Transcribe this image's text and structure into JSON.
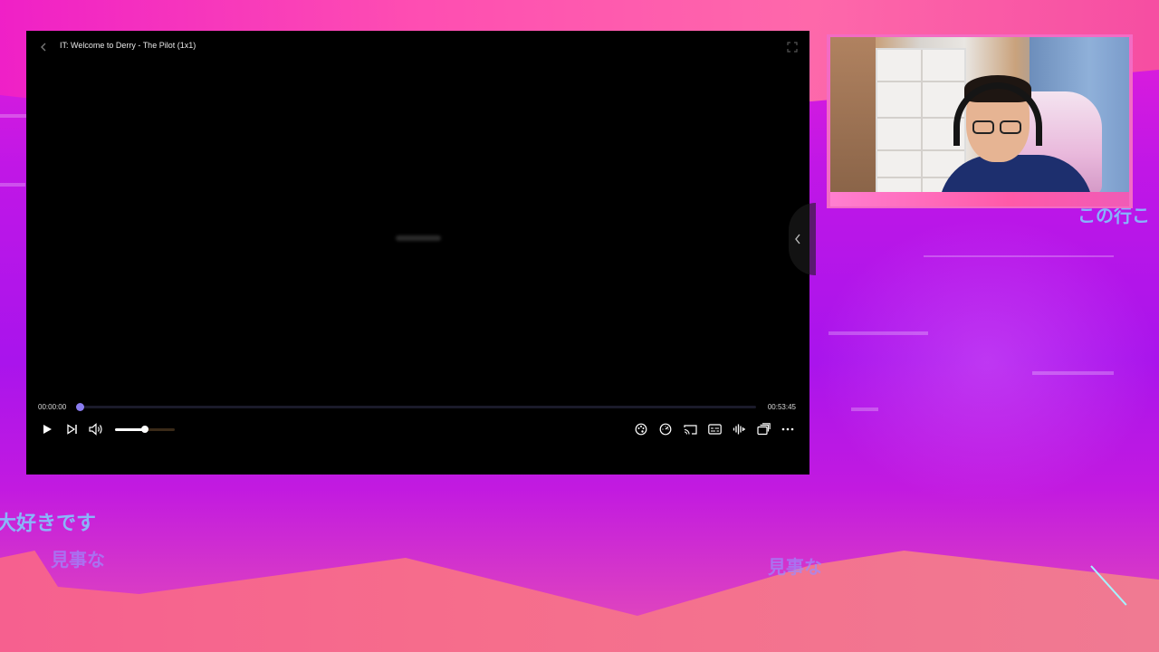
{
  "player": {
    "title": "IT: Welcome to Derry - The Pilot (1x1)",
    "time_current": "00:00:00",
    "time_total": "00:53:45",
    "progress_fraction": 0.0,
    "volume_fraction": 0.5,
    "accent_color": "#8a7cf0"
  },
  "overlay_text": {
    "jp_1": "大好きです",
    "jp_2": "見事な",
    "jp_3": "見事な",
    "jp_4": "この行こ"
  },
  "icons": {
    "back": "chevron-left-icon",
    "fullscreen": "fullscreen-icon",
    "side_panel": "chevron-left-icon",
    "play": "play-icon",
    "next": "skip-next-icon",
    "volume": "volume-icon",
    "theme": "palette-icon",
    "speed": "speedometer-icon",
    "cast": "cast-icon",
    "subtitles": "subtitles-icon",
    "audio": "audio-track-icon",
    "episodes": "episodes-icon",
    "more": "more-icon"
  }
}
